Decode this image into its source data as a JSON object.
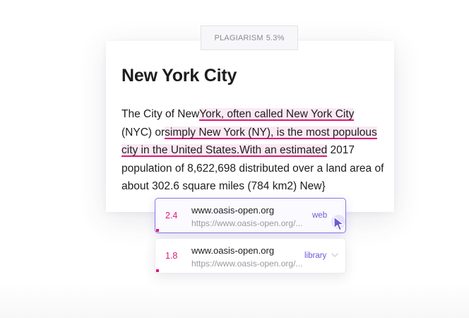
{
  "badge": {
    "label": "PLAGIARISM",
    "percent": "5.3%"
  },
  "document": {
    "title": "New York City",
    "segments": [
      {
        "text": "The City of New",
        "highlighted": false
      },
      {
        "text": "York, often called New York City",
        "highlighted": true
      },
      {
        "text": " (NYC) or",
        "highlighted": false
      },
      {
        "text": "simply New York (NY), is the most populous city in the United States.With an estimated",
        "highlighted": true
      },
      {
        "text": " 2017 population of 8,622,698 distributed over a land area of about 302.6 square miles (784 km2) New}",
        "highlighted": false
      }
    ]
  },
  "sources": [
    {
      "score": "2.4",
      "domain": "www.oasis-open.org",
      "url": "https://www.oasis-open.org/...",
      "kind": "web",
      "selected": true
    },
    {
      "score": "1.8",
      "domain": "www.oasis-open.org",
      "url": "https://www.oasis-open.org/...",
      "kind": "library",
      "selected": false
    }
  ],
  "colors": {
    "highlight_underline": "#e0197a",
    "highlight_fill": "#fbe9f3",
    "accent": "#6e5ad2",
    "score": "#e0197a"
  },
  "icons": {
    "cursor": "cursor-arrow-icon",
    "dropdown": "chevron-down-icon"
  }
}
